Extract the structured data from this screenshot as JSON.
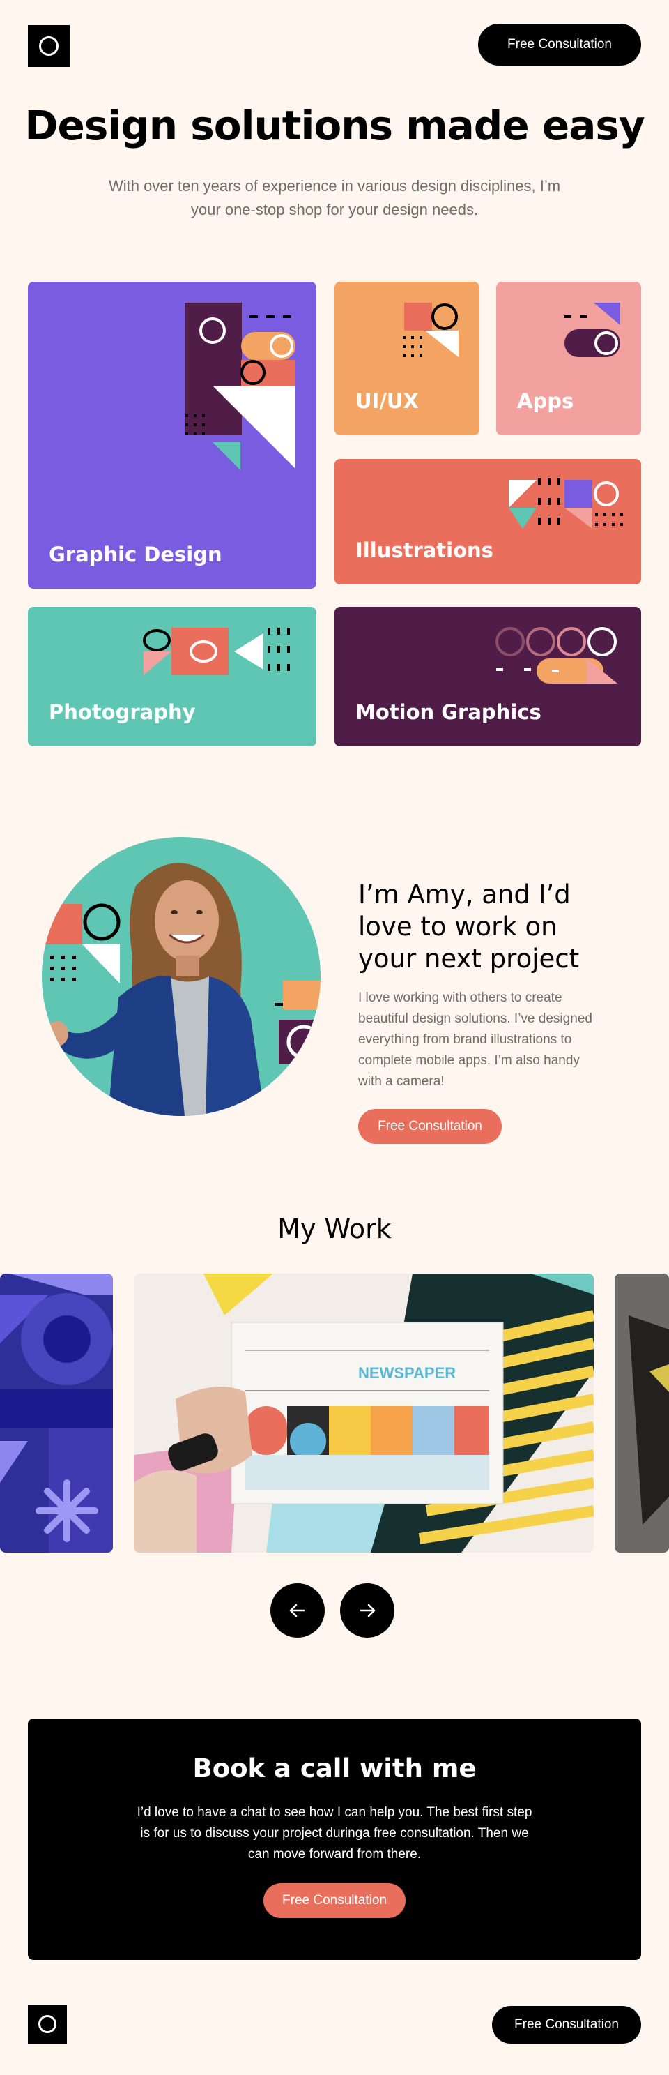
{
  "header": {
    "logo": "logo-ring-icon",
    "cta_label": "Free Consultation"
  },
  "hero": {
    "title": "Design solutions made easy",
    "subtitle": "With over ten years of experience in various design disciplines, I’m your one-stop shop for your design needs."
  },
  "services": [
    {
      "label": "Graphic Design",
      "color": "#7A5CE0"
    },
    {
      "label": "UI/UX",
      "color": "#F4A462"
    },
    {
      "label": "Apps",
      "color": "#F2A19E"
    },
    {
      "label": "Illustrations",
      "color": "#E96E5C"
    },
    {
      "label": "Photography",
      "color": "#5EC6B3"
    },
    {
      "label": "Motion Graphics",
      "color": "#4F1D48"
    }
  ],
  "about": {
    "title": "I’m Amy, and I’d love to work on your next project",
    "body": "I love working with others to create beautiful design solutions. I’ve designed everything from brand illustrations to complete mobile apps. I’m also handy with a camera!",
    "cta_label": "Free Consultation"
  },
  "work": {
    "title": "My Work",
    "newspaper_text": "NEWSPAPER",
    "prev_icon": "arrow-left-icon",
    "next_icon": "arrow-right-icon"
  },
  "cta": {
    "title": "Book a call with me",
    "body": "I’d love to have a chat to see how I can help you. The best first step is for us to discuss your project duringa free consultation. Then we can move forward from there.",
    "button_label": "Free Consultation"
  },
  "footer": {
    "logo": "logo-ring-icon",
    "cta_label": "Free Consultation"
  },
  "colors": {
    "background": "#FFF6EF",
    "coral": "#E96E5C",
    "purple": "#7A5CE0",
    "orange": "#F4A462",
    "pink": "#F2A19E",
    "teal": "#5EC6B3",
    "plum": "#4F1D48"
  }
}
